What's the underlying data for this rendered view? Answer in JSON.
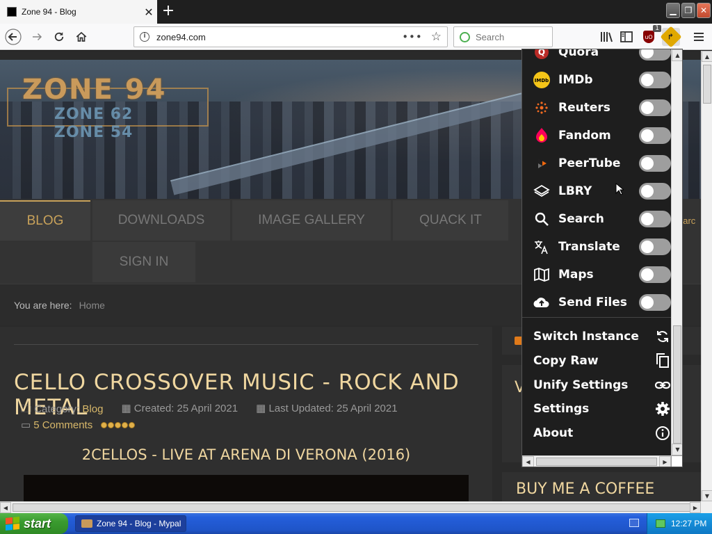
{
  "browser": {
    "tab_title": "Zone 94 - Blog",
    "url": "zone94.com",
    "search_placeholder": "Search",
    "ublock_badge": "1"
  },
  "site": {
    "logo_main": "ZONE 94",
    "logo_sub1": "ZONE 62",
    "logo_sub2": "ZONE 54",
    "menu": [
      "BLOG",
      "DOWNLOADS",
      "IMAGE GALLERY",
      "QUACK IT",
      "SIGN IN"
    ],
    "active_menu": "BLOG",
    "breadcrumb_label": "You are here:",
    "breadcrumb_home": "Home",
    "search_peek": "earc",
    "side_initial": "V",
    "coffee": "BUY ME A COFFEE"
  },
  "article": {
    "title": "CELLO CROSSOVER MUSIC - ROCK AND METAL",
    "category_label": "Category:",
    "category": "Blog",
    "created": "Created: 25 April 2021",
    "updated": "Last Updated: 25 April 2021",
    "comments": "5 Comments",
    "rating_stars": 5,
    "subtitle": "2CELLOS - LIVE AT ARENA DI VERONA (2016)"
  },
  "popup": {
    "services": [
      {
        "label": "Quora",
        "icon": "quora-icon",
        "enabled": false
      },
      {
        "label": "IMDb",
        "icon": "imdb-icon",
        "enabled": false
      },
      {
        "label": "Reuters",
        "icon": "reuters-icon",
        "enabled": false
      },
      {
        "label": "Fandom",
        "icon": "fandom-icon",
        "enabled": false
      },
      {
        "label": "PeerTube",
        "icon": "peertube-icon",
        "enabled": false
      },
      {
        "label": "LBRY",
        "icon": "lbry-icon",
        "enabled": false
      },
      {
        "label": "Search",
        "icon": "search-icon",
        "enabled": false
      },
      {
        "label": "Translate",
        "icon": "translate-icon",
        "enabled": false
      },
      {
        "label": "Maps",
        "icon": "map-icon",
        "enabled": false
      },
      {
        "label": "Send Files",
        "icon": "cloud-upload-icon",
        "enabled": false
      }
    ],
    "actions": [
      {
        "label": "Switch Instance",
        "icon": "refresh-icon"
      },
      {
        "label": "Copy Raw",
        "icon": "copy-icon"
      },
      {
        "label": "Unify Settings",
        "icon": "link-icon"
      },
      {
        "label": "Settings",
        "icon": "gear-icon"
      },
      {
        "label": "About",
        "icon": "info-icon"
      }
    ]
  },
  "taskbar": {
    "start": "start",
    "window": "Zone 94 - Blog - Mypal",
    "clock": "12:27 PM"
  },
  "colors": {
    "accent_gold": "#c9a25a",
    "title_cream": "#f0d7a0",
    "popup_bg": "#1e1e1e",
    "toggle_off": "#9e9e9e"
  }
}
